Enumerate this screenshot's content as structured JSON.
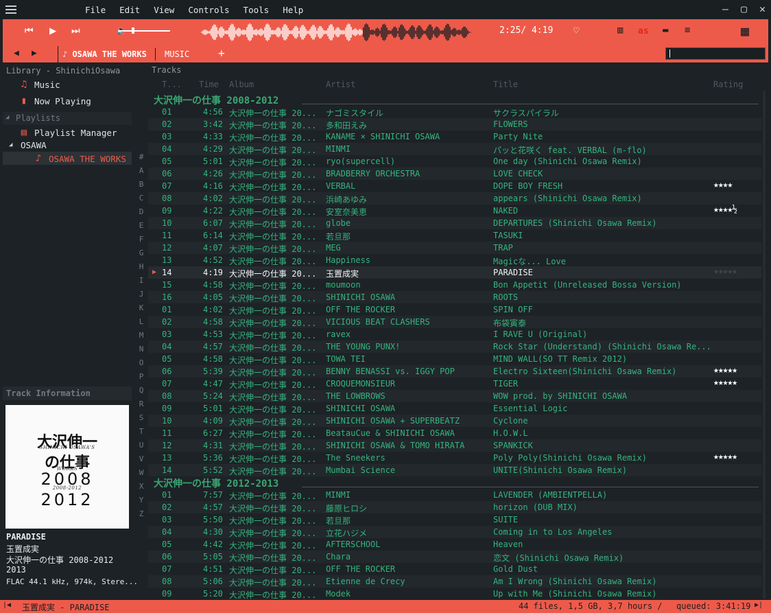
{
  "menu": [
    "File",
    "Edit",
    "View",
    "Controls",
    "Tools",
    "Help"
  ],
  "transport": {
    "time": "2:25/ 4:19"
  },
  "tabs": {
    "active": "OSAWA THE WORKS",
    "other": "MUSIC",
    "add": "+"
  },
  "left": {
    "library_title": "Library - ShinichiOsawa",
    "music": "Music",
    "now_playing": "Now Playing",
    "playlists": "Playlists",
    "playlist_manager": "Playlist Manager",
    "osawa": "OSAWA",
    "osawa_works": "OSAWA THE WORKS",
    "track_info_title": "Track Information"
  },
  "cover": {
    "line1": "大沢伸一",
    "line2": "SHINICHI OSAWA'S",
    "line3": "の仕事",
    "line4": "WORKS",
    "line5": "2008",
    "line6": "2008-2012",
    "line7": "2012"
  },
  "info": {
    "title": "PARADISE",
    "artist": "玉置成実",
    "album": "大沢伸一の仕事 2008-2012",
    "year": "2013",
    "format": "FLAC 44.1 kHz, 974k, Stere..."
  },
  "alpha": [
    "#",
    "A",
    "B",
    "C",
    "D",
    "E",
    "F",
    "G",
    "H",
    "I",
    "J",
    "K",
    "L",
    "M",
    "N",
    "O",
    "P",
    "Q",
    "R",
    "S",
    "T",
    "U",
    "V",
    "W",
    "X",
    "Y",
    "Z"
  ],
  "tracks_title": "Tracks",
  "columns": {
    "no": "T...",
    "time": "Time",
    "album": "Album",
    "artist": "Artist",
    "title": "Title",
    "rating": "Rating"
  },
  "groups": [
    {
      "name": "大沢伸一の仕事 2008-2012"
    },
    {
      "name": "大沢伸一の仕事 2012-2013"
    }
  ],
  "rows": [
    {
      "no": "01",
      "time": "4:56",
      "album": "大沢伸一の仕事 20...",
      "artist": "ナゴミスタイル",
      "title": "サクラスパイラル",
      "rating": ""
    },
    {
      "no": "02",
      "time": "3:42",
      "album": "大沢伸一の仕事 20...",
      "artist": "多和田えみ",
      "title": "FLOWERS",
      "rating": ""
    },
    {
      "no": "03",
      "time": "4:33",
      "album": "大沢伸一の仕事 20...",
      "artist": "KANAME × SHINICHI OSAWA",
      "title": "Party Nite",
      "rating": ""
    },
    {
      "no": "04",
      "time": "4:29",
      "album": "大沢伸一の仕事 20...",
      "artist": "MINMI",
      "title": "パッと花咲く feat. VERBAL (m-flo)",
      "rating": ""
    },
    {
      "no": "05",
      "time": "5:01",
      "album": "大沢伸一の仕事 20...",
      "artist": "ryo(supercell)",
      "title": "One day (Shinichi Osawa Remix)",
      "rating": ""
    },
    {
      "no": "06",
      "time": "4:26",
      "album": "大沢伸一の仕事 20...",
      "artist": "BRADBERRY ORCHESTRA",
      "title": "LOVE CHECK",
      "rating": ""
    },
    {
      "no": "07",
      "time": "4:16",
      "album": "大沢伸一の仕事 20...",
      "artist": "VERBAL",
      "title": "DOPE BOY FRESH",
      "rating": "★★★★"
    },
    {
      "no": "08",
      "time": "4:02",
      "album": "大沢伸一の仕事 20...",
      "artist": "浜崎あゆみ",
      "title": "appears (Shinichi Osawa Remix)",
      "rating": ""
    },
    {
      "no": "09",
      "time": "4:22",
      "album": "大沢伸一の仕事 20...",
      "artist": "安室奈美恵",
      "title": "NAKED",
      "rating": "★★★★½"
    },
    {
      "no": "10",
      "time": "6:07",
      "album": "大沢伸一の仕事 20...",
      "artist": "globe",
      "title": "DEPARTURES (Shinichi Osawa Remix)",
      "rating": ""
    },
    {
      "no": "11",
      "time": "6:14",
      "album": "大沢伸一の仕事 20...",
      "artist": "若旦那",
      "title": "TASUKI",
      "rating": ""
    },
    {
      "no": "12",
      "time": "4:07",
      "album": "大沢伸一の仕事 20...",
      "artist": "MEG",
      "title": "TRAP",
      "rating": ""
    },
    {
      "no": "13",
      "time": "4:52",
      "album": "大沢伸一の仕事 20...",
      "artist": "Happiness",
      "title": "Magicな... Love",
      "rating": ""
    },
    {
      "no": "14",
      "time": "4:19",
      "album": "大沢伸一の仕事 20...",
      "artist": "玉置成実",
      "title": "PARADISE",
      "rating": "★★★★★",
      "playing": true
    },
    {
      "no": "15",
      "time": "4:58",
      "album": "大沢伸一の仕事 20...",
      "artist": "moumoon",
      "title": "Bon Appetit (Unreleased Bossa Version)",
      "rating": ""
    },
    {
      "no": "16",
      "time": "4:05",
      "album": "大沢伸一の仕事 20...",
      "artist": "SHINICHI OSAWA",
      "title": "ROOTS",
      "rating": ""
    },
    {
      "no": "01",
      "time": "4:02",
      "album": "大沢伸一の仕事 20...",
      "artist": "OFF THE ROCKER",
      "title": "SPIN OFF",
      "rating": ""
    },
    {
      "no": "02",
      "time": "4:58",
      "album": "大沢伸一の仕事 20...",
      "artist": "VICIOUS BEAT CLASHERS",
      "title": "布袋寅泰",
      "rating": ""
    },
    {
      "no": "03",
      "time": "4:53",
      "album": "大沢伸一の仕事 20...",
      "artist": "ravex",
      "title": "I RAVE U (Original)",
      "rating": ""
    },
    {
      "no": "04",
      "time": "4:57",
      "album": "大沢伸一の仕事 20...",
      "artist": "THE YOUNG PUNX!",
      "title": "Rock Star (Understand) (Shinichi Osawa Re...",
      "rating": ""
    },
    {
      "no": "05",
      "time": "4:58",
      "album": "大沢伸一の仕事 20...",
      "artist": "TOWA TEI",
      "title": "MIND WALL(SO TT Remix 2012)",
      "rating": ""
    },
    {
      "no": "06",
      "time": "5:39",
      "album": "大沢伸一の仕事 20...",
      "artist": "BENNY BENASSI vs. IGGY POP",
      "title": "Electro Sixteen(Shinichi Osawa Remix)",
      "rating": "★★★★★"
    },
    {
      "no": "07",
      "time": "4:47",
      "album": "大沢伸一の仕事 20...",
      "artist": "CROQUEMONSIEUR",
      "title": "TIGER",
      "rating": "★★★★★"
    },
    {
      "no": "08",
      "time": "5:24",
      "album": "大沢伸一の仕事 20...",
      "artist": "THE LOWBROWS",
      "title": "WOW prod. by SHINICHI OSAWA",
      "rating": ""
    },
    {
      "no": "09",
      "time": "5:01",
      "album": "大沢伸一の仕事 20...",
      "artist": "SHINICHI OSAWA",
      "title": "Essential Logic",
      "rating": ""
    },
    {
      "no": "10",
      "time": "4:09",
      "album": "大沢伸一の仕事 20...",
      "artist": "SHINICHI OSAWA + SUPERBEATZ",
      "title": "Cyclone",
      "rating": ""
    },
    {
      "no": "11",
      "time": "6:27",
      "album": "大沢伸一の仕事 20...",
      "artist": "BeatauCue & SHINICHI OSAWA",
      "title": "H.O.W.L",
      "rating": ""
    },
    {
      "no": "12",
      "time": "4:31",
      "album": "大沢伸一の仕事 20...",
      "artist": "SHINICHI OSAWA & TOMO HIRATA",
      "title": "SPANKICK",
      "rating": ""
    },
    {
      "no": "13",
      "time": "5:36",
      "album": "大沢伸一の仕事 20...",
      "artist": "The Sneekers",
      "title": "Poly Poly(Shinichi Osawa Remix)",
      "rating": "★★★★★"
    },
    {
      "no": "14",
      "time": "5:52",
      "album": "大沢伸一の仕事 20...",
      "artist": "Mumbai Science",
      "title": "UNITE(Shinichi Osawa Remix)",
      "rating": ""
    },
    {
      "no": "01",
      "time": "7:57",
      "album": "大沢伸一の仕事 20...",
      "artist": "MINMI",
      "title": "LAVENDER (AMBIENTPELLA)",
      "rating": ""
    },
    {
      "no": "02",
      "time": "4:57",
      "album": "大沢伸一の仕事 20...",
      "artist": "藤原ヒロシ",
      "title": "horizon (DUB MIX)",
      "rating": ""
    },
    {
      "no": "03",
      "time": "5:50",
      "album": "大沢伸一の仕事 20...",
      "artist": "若旦那",
      "title": "SUITE",
      "rating": ""
    },
    {
      "no": "04",
      "time": "4:30",
      "album": "大沢伸一の仕事 20...",
      "artist": "立花ハジメ",
      "title": "Coming in to Los Angeles",
      "rating": ""
    },
    {
      "no": "05",
      "time": "4:42",
      "album": "大沢伸一の仕事 20...",
      "artist": "AFTERSCHOOL",
      "title": "Heaven",
      "rating": ""
    },
    {
      "no": "06",
      "time": "5:05",
      "album": "大沢伸一の仕事 20...",
      "artist": "Chara",
      "title": "恋文 (Shinichi Osawa Remix)",
      "rating": ""
    },
    {
      "no": "07",
      "time": "4:51",
      "album": "大沢伸一の仕事 20...",
      "artist": "OFF THE ROCKER",
      "title": "Gold Dust",
      "rating": ""
    },
    {
      "no": "08",
      "time": "5:06",
      "album": "大沢伸一の仕事 20...",
      "artist": "Etienne de Crecy",
      "title": "Am I Wrong (Shinichi Osawa Remix)",
      "rating": ""
    },
    {
      "no": "09",
      "time": "5:20",
      "album": "大沢伸一の仕事 20...",
      "artist": "Modek",
      "title": "Up with Me (Shinichi Osawa Remix)",
      "rating": ""
    }
  ],
  "status": {
    "left": "玉置成実 - PARADISE",
    "files": "44 files, 1,5 GB, 3,7 hours /",
    "queued": "queued: 3:41:19"
  }
}
